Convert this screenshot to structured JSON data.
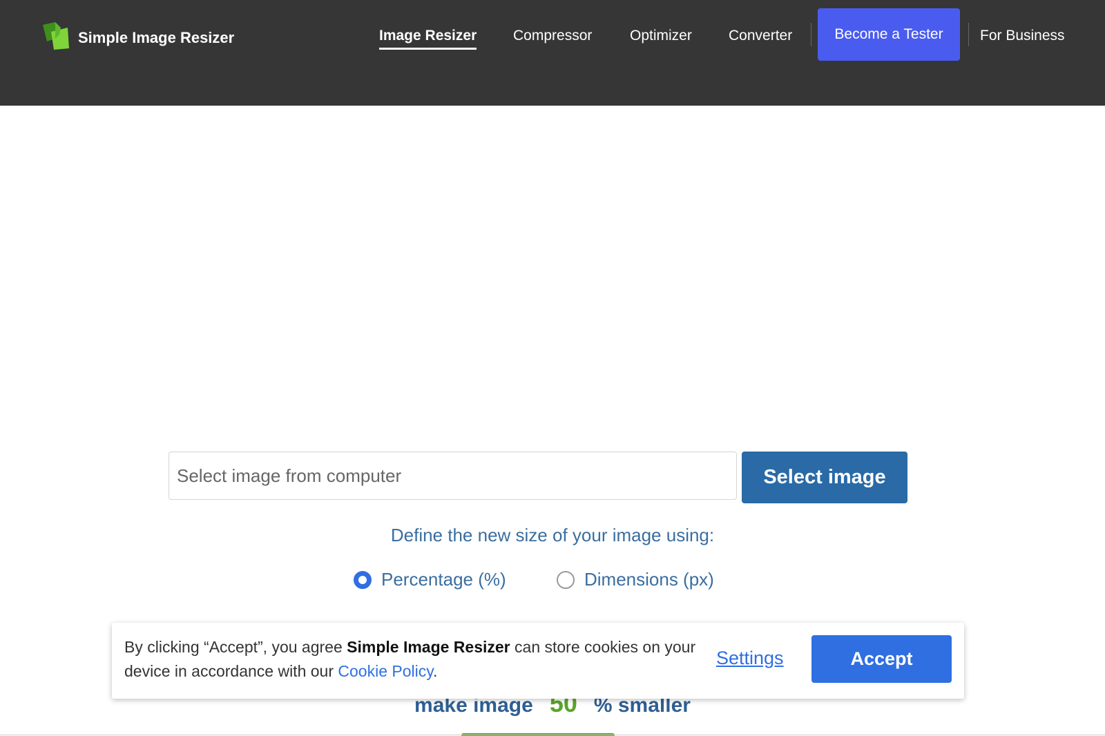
{
  "header": {
    "brand": "Simple Image Resizer",
    "nav": {
      "image_resizer": "Image Resizer",
      "compressor": "Compressor",
      "optimizer": "Optimizer",
      "converter": "Converter",
      "become_tester": "Become a Tester",
      "for_business": "For Business"
    },
    "active_nav": "Image Resizer"
  },
  "upload": {
    "placeholder": "Select image from computer",
    "button_label": "Select image"
  },
  "resize_options": {
    "prompt": "Define the new size of your image using:",
    "options": [
      {
        "label": "Percentage (%)",
        "checked": true
      },
      {
        "label": "Dimensions (px)",
        "checked": false
      }
    ]
  },
  "make_smaller": {
    "prefix": "make image",
    "value": "50",
    "suffix": "% smaller"
  },
  "cookie_banner": {
    "text_before": "By clicking “Accept”, you agree ",
    "brand": "Simple Image Resizer",
    "text_middle": " can store cookies on your device in accordance with our ",
    "policy_link": "Cookie Policy",
    "text_end": ".",
    "settings_label": "Settings",
    "accept_label": "Accept"
  },
  "colors": {
    "header_bg": "#363636",
    "tester_button": "#4a5cf0",
    "select_button": "#2a6aa6",
    "accent_blue": "#2f6fe2",
    "accent_green": "#5aa52a",
    "prompt_text": "#3a6ea0"
  }
}
